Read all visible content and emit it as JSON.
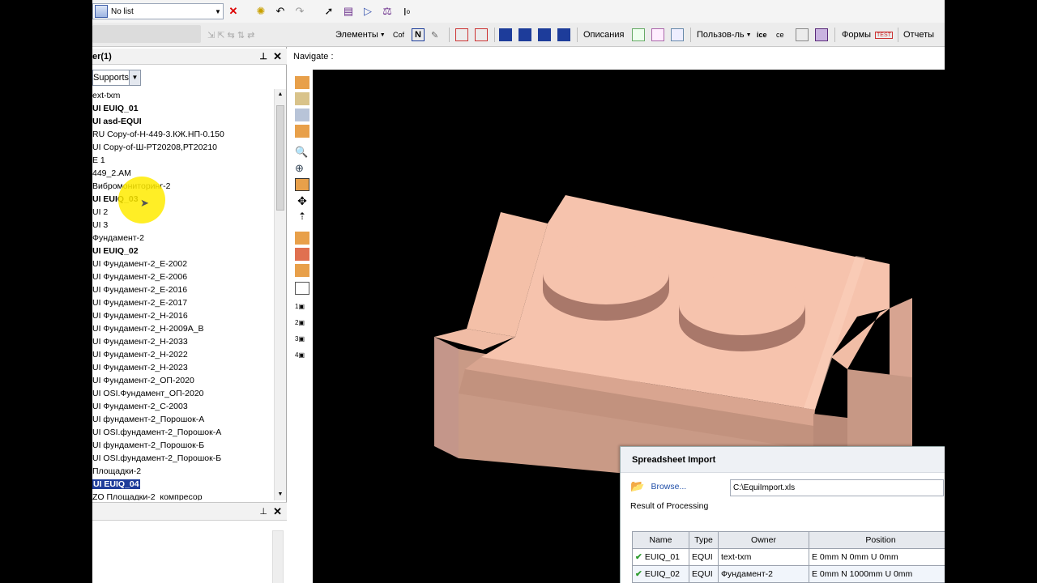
{
  "toolbar": {
    "list_select": "No list",
    "row2": {
      "elements": "Элементы",
      "cof": "Cof",
      "descriptions": "Описания",
      "user": "Пользов-ль",
      "forms": "Формы",
      "reports": "Отчеты"
    }
  },
  "left_panel": {
    "title": "er(1)",
    "filter": "Supports",
    "items": [
      {
        "label": "ext-txm",
        "bold": false
      },
      {
        "label": "UI EUIQ_01",
        "bold": true
      },
      {
        "label": "UI asd-EQUI",
        "bold": true
      },
      {
        "label": "RU Copy-of-Н-449-3.КЖ.НП-0.150",
        "bold": false
      },
      {
        "label": "UI Copy-of-Ш-РТ20208,РТ20210",
        "bold": false
      },
      {
        "label": "E 1",
        "bold": false
      },
      {
        "label": "449_2.АМ",
        "bold": false
      },
      {
        "label": "Вибромониторинг-2",
        "bold": false
      },
      {
        "label": "UI EUIQ_03",
        "bold": true
      },
      {
        "label": "UI 2",
        "bold": false
      },
      {
        "label": "UI 3",
        "bold": false
      },
      {
        "label": "Фундамент-2",
        "bold": false
      },
      {
        "label": "UI EUIQ_02",
        "bold": true
      },
      {
        "label": "UI Фундамент-2_Е-2002",
        "bold": false
      },
      {
        "label": "UI Фундамент-2_Е-2006",
        "bold": false
      },
      {
        "label": "UI Фундамент-2_Е-2016",
        "bold": false
      },
      {
        "label": "UI Фундамент-2_Е-2017",
        "bold": false
      },
      {
        "label": "UI Фундамент-2_Н-2016",
        "bold": false
      },
      {
        "label": "UI Фундамент-2_Н-2009А_В",
        "bold": false
      },
      {
        "label": "UI Фундамент-2_Н-2033",
        "bold": false
      },
      {
        "label": "UI Фундамент-2_Н-2022",
        "bold": false
      },
      {
        "label": "UI Фундамент-2_Н-2023",
        "bold": false
      },
      {
        "label": "UI Фундамент-2_ОП-2020",
        "bold": false
      },
      {
        "label": "UI OSI.Фундамент_ОП-2020",
        "bold": false
      },
      {
        "label": "UI Фундамент-2_С-2003",
        "bold": false
      },
      {
        "label": "UI фундамент-2_Порошок-А",
        "bold": false
      },
      {
        "label": "UI OSI.фундамент-2_Порошок-А",
        "bold": false
      },
      {
        "label": "UI фундамент-2_Порошок-Б",
        "bold": false
      },
      {
        "label": "UI OSI.фундамент-2_Порошок-Б",
        "bold": false
      },
      {
        "label": "Площадки-2",
        "bold": false
      },
      {
        "label": "UI EUIQ_04",
        "bold": true,
        "selected": true
      },
      {
        "label": "ZO Площадки-2_компресор",
        "bold": false
      }
    ]
  },
  "navigate": {
    "label": "Navigate :"
  },
  "dialog": {
    "title": "Spreadsheet Import",
    "browse": "Browse...",
    "path": "C:\\EquiImport.xls",
    "result_label": "Result of Processing",
    "columns": [
      "Name",
      "Type",
      "Owner",
      "Position"
    ],
    "rows": [
      {
        "name": "EUIQ_01",
        "type": "EQUI",
        "owner": "text-txm",
        "position": "E 0mm N 0mm U 0mm"
      },
      {
        "name": "EUIQ_02",
        "type": "EQUI",
        "owner": "Фундамент-2",
        "position": "E 0mm N 1000mm U 0mm"
      }
    ]
  },
  "colors": {
    "model_top": "#f6c3ad",
    "model_side": "#c99a86",
    "selection": "#1f3d9a",
    "highlight": "#ffeb00"
  }
}
